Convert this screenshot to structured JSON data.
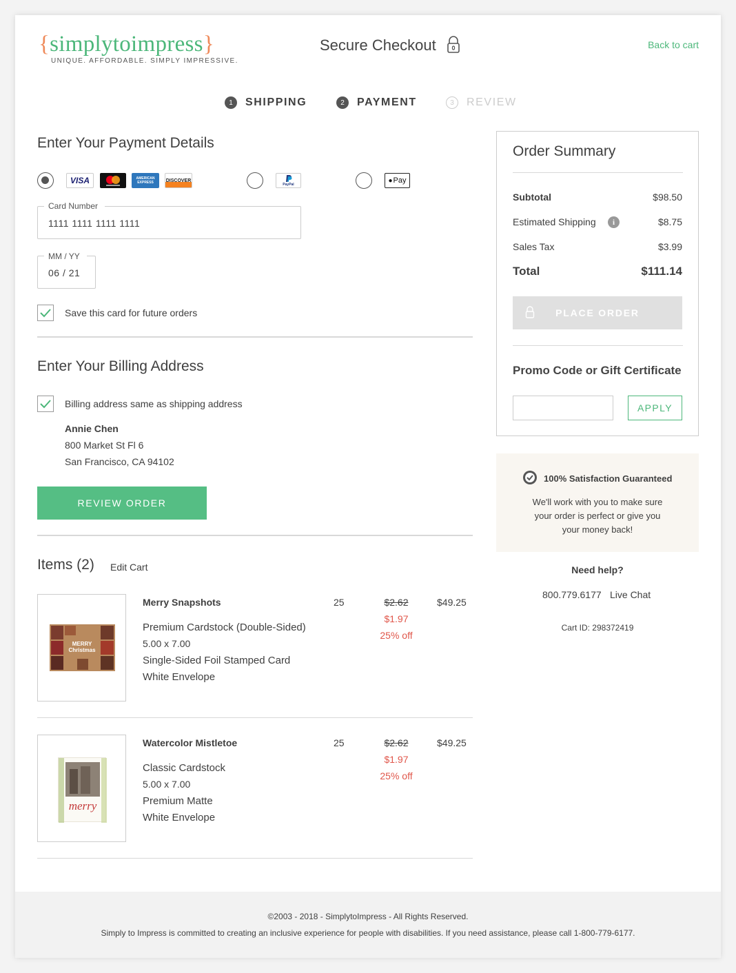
{
  "header": {
    "logo_open_brace": "{",
    "logo_text": "simplytoimpress",
    "logo_close_brace": "}",
    "logo_tagline": "UNIQUE. AFFORDABLE. SIMPLY IMPRESSIVE.",
    "title": "Secure Checkout",
    "back_link": "Back to cart"
  },
  "steps": [
    {
      "num": "1",
      "label": "SHIPPING"
    },
    {
      "num": "2",
      "label": "PAYMENT"
    },
    {
      "num": "3",
      "label": "REVIEW"
    }
  ],
  "payment": {
    "heading": "Enter Your Payment Details",
    "card_logos": [
      "VISA",
      "mastercard",
      "AMERICAN EXPRESS",
      "DISCOVER"
    ],
    "paypal_label": "PayPal",
    "applepay_label": "Pay",
    "card_number_label": "Card Number",
    "card_number_value": "1111 1111 1111 1111",
    "expiry_label": "MM / YY",
    "expiry_value": "06 / 21",
    "save_card_label": "Save this card for future orders"
  },
  "billing": {
    "heading": "Enter Your Billing Address",
    "same_as_shipping_label": "Billing address same as shipping address",
    "name": "Annie Chen",
    "street": "800 Market St Fl 6",
    "city": "San Francisco, CA 94102",
    "review_button": "REVIEW ORDER"
  },
  "items": {
    "heading": "Items (2)",
    "edit_cart": "Edit Cart",
    "list": [
      {
        "name": "Merry Snapshots",
        "details": [
          "Premium Cardstock (Double-Sided)",
          "5.00 x 7.00",
          "Single-Sided Foil Stamped Card",
          "White Envelope"
        ],
        "qty": "25",
        "orig_price": "$2.62",
        "sale_price": "$1.97",
        "discount": "25% off",
        "total": "$49.25",
        "thumb_text": "MERRY Christmas"
      },
      {
        "name": "Watercolor Mistletoe",
        "details": [
          "Classic Cardstock",
          "5.00 x 7.00",
          "Premium Matte",
          "White Envelope"
        ],
        "qty": "25",
        "orig_price": "$2.62",
        "sale_price": "$1.97",
        "discount": "25% off",
        "total": "$49.25",
        "thumb_text": "merry"
      }
    ]
  },
  "summary": {
    "heading": "Order Summary",
    "subtotal_label": "Subtotal",
    "subtotal_value": "$98.50",
    "shipping_label": "Estimated Shipping",
    "shipping_value": "$8.75",
    "tax_label": "Sales Tax",
    "tax_value": "$3.99",
    "total_label": "Total",
    "total_value": "$111.14",
    "place_order": "PLACE ORDER",
    "promo_heading": "Promo Code or Gift Certificate",
    "apply": "APPLY"
  },
  "guarantee": {
    "title": "100% Satisfaction Guaranteed",
    "line1": "We'll work with you to make sure",
    "line2": "your order is perfect or give you",
    "line3": "your money back!"
  },
  "help": {
    "heading": "Need help?",
    "phone": "800.779.6177",
    "chat": "Live Chat",
    "cart_id": "Cart ID: 298372419"
  },
  "footer": {
    "copyright": "©2003 - 2018 - SimplytoImpress - All Rights Reserved.",
    "accessibility": "Simply to Impress is committed to creating an inclusive experience for people with disabilities. If you need assistance, please call 1-800-779-6177."
  },
  "colors": {
    "accent": "#4cb77a",
    "sale": "#e0564a",
    "logo_brace": "#ef8a5a"
  }
}
